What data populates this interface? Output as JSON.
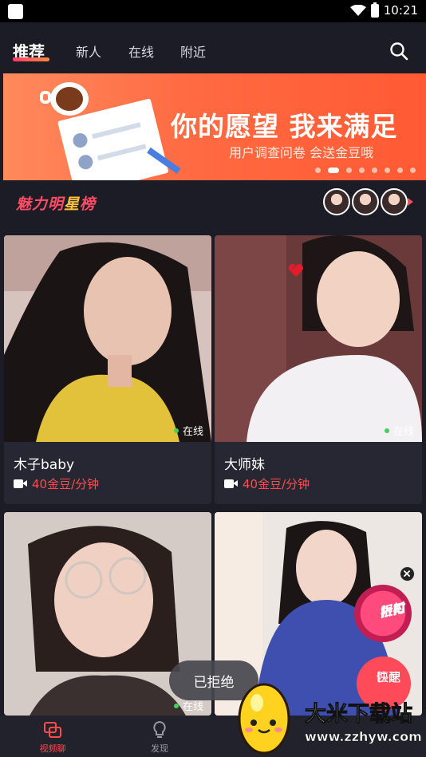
{
  "status_bar": {
    "time": "10:21",
    "icons": [
      "notification-square-icon",
      "wifi-icon",
      "battery-icon"
    ]
  },
  "top_nav": {
    "tabs": [
      {
        "label": "推荐",
        "active": true
      },
      {
        "label": "新人",
        "active": false
      },
      {
        "label": "在线",
        "active": false
      },
      {
        "label": "附近",
        "active": false
      }
    ],
    "search_icon": "search-icon",
    "accent_gradient": [
      "#ff3b6b",
      "#ff8a3c"
    ]
  },
  "banner": {
    "title": "你的愿望 我来满足",
    "subtitle": "用户调查问卷 会送金豆哦",
    "page_count": 9,
    "active_page": 2,
    "background": "#ff6a42"
  },
  "charm_ranking": {
    "title_part1": "魅力明",
    "title_part2": "星",
    "title_part3": "榜",
    "avatar_count": 3
  },
  "cards": [
    {
      "name": "木子baby",
      "price": "40金豆/分钟",
      "status": "在线"
    },
    {
      "name": "大师妹",
      "price": "40金豆/分钟",
      "status": "在线"
    },
    {
      "name": "",
      "price": "",
      "status": "在线"
    },
    {
      "name": "",
      "price": "",
      "status": ""
    }
  ],
  "toast": {
    "text": "已拒绝"
  },
  "promo": {
    "badge_line1": "限时",
    "badge_line2": "折扣",
    "match_line1": "快速",
    "match_line2": "匹配",
    "close_icon": "close-icon"
  },
  "bottom_nav": {
    "items": [
      {
        "label": "视频聊",
        "icon": "video-chat-icon",
        "active": true
      },
      {
        "label": "发现",
        "icon": "lightbulb-icon",
        "active": false
      }
    ],
    "active_color": "#ff4b4b"
  },
  "watermark": {
    "title": "大米下载站",
    "url": "www.zzhyw.com"
  }
}
